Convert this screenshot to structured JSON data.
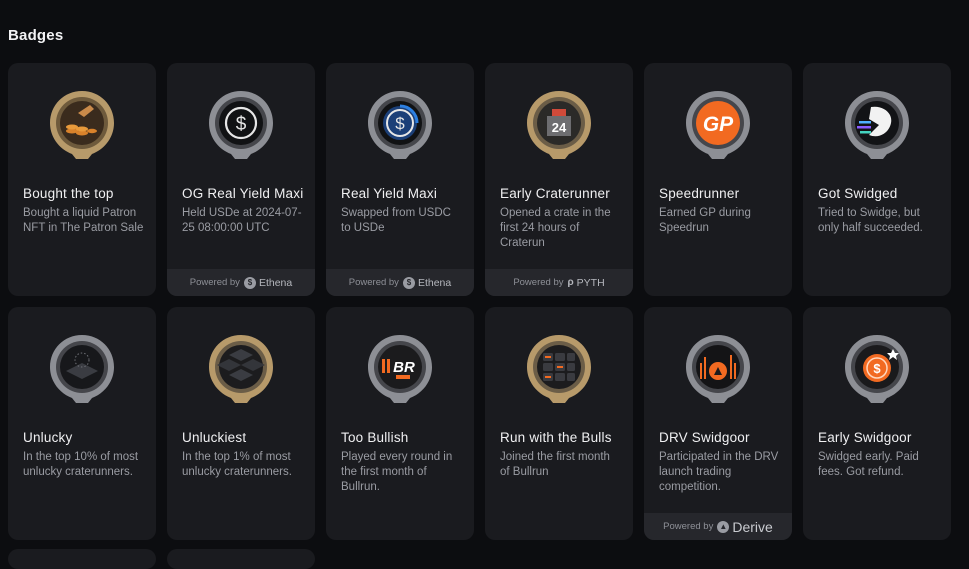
{
  "section": {
    "title": "Badges"
  },
  "colors": {
    "gold": "#b79a6a",
    "silver": "#8d8f95",
    "orange": "#f26a21",
    "blue": "#2d7fe0"
  },
  "badges": [
    {
      "title": "Bought the top",
      "desc": "Bought a liquid Patron NFT in The Patron Sale",
      "rim": "gold",
      "icon": "coins-hand-icon"
    },
    {
      "title": "OG Real Yield Maxi",
      "desc": "Held USDe at 2024-07-25 08:00:00 UTC",
      "rim": "silver",
      "icon": "dollar-coin-icon",
      "powered_label": "Powered by",
      "powered_brand": "Ethena"
    },
    {
      "title": "Real Yield Maxi",
      "desc": "Swapped from USDC to USDe",
      "rim": "silver",
      "icon": "dollar-coin-blue-icon",
      "powered_label": "Powered by",
      "powered_brand": "Ethena"
    },
    {
      "title": "Early Craterunner",
      "desc": "Opened a crate in the first 24 hours of Craterun",
      "rim": "gold",
      "icon": "crate-24-icon",
      "icon_text": "24",
      "powered_label": "Powered by",
      "powered_brand": "PYTH"
    },
    {
      "title": "Speedrunner",
      "desc": "Earned GP during Speedrun",
      "rim": "silver",
      "icon": "gp-icon",
      "icon_text": "GP"
    },
    {
      "title": "Got Swidged",
      "desc": "Tried to Swidge, but only half succeeded.",
      "rim": "silver",
      "icon": "swidge-bolt-icon"
    },
    {
      "title": "Unlucky",
      "desc": "In the top 10% of most unlucky craterunners.",
      "rim": "silver",
      "icon": "dark-tile-icon"
    },
    {
      "title": "Unluckiest",
      "desc": "In the top 1% of most unlucky craterunners.",
      "rim": "gold",
      "icon": "dark-tiles-icon"
    },
    {
      "title": "Too Bullish",
      "desc": "Played every round in the first month of Bullrun.",
      "rim": "silver",
      "icon": "br-logo-icon",
      "icon_text": "BR"
    },
    {
      "title": "Run with the Bulls",
      "desc": "Joined the first month of Bullrun",
      "rim": "gold",
      "icon": "br-tiles-icon"
    },
    {
      "title": "DRV Swidgoor",
      "desc": "Participated in the DRV launch trading competition.",
      "rim": "silver",
      "icon": "drv-chart-icon",
      "powered_label": "Powered by",
      "powered_brand": "Derive"
    },
    {
      "title": "Early Swidgoor",
      "desc": "Swidged early. Paid fees. Got refund.",
      "rim": "silver",
      "icon": "refund-coin-icon"
    }
  ]
}
